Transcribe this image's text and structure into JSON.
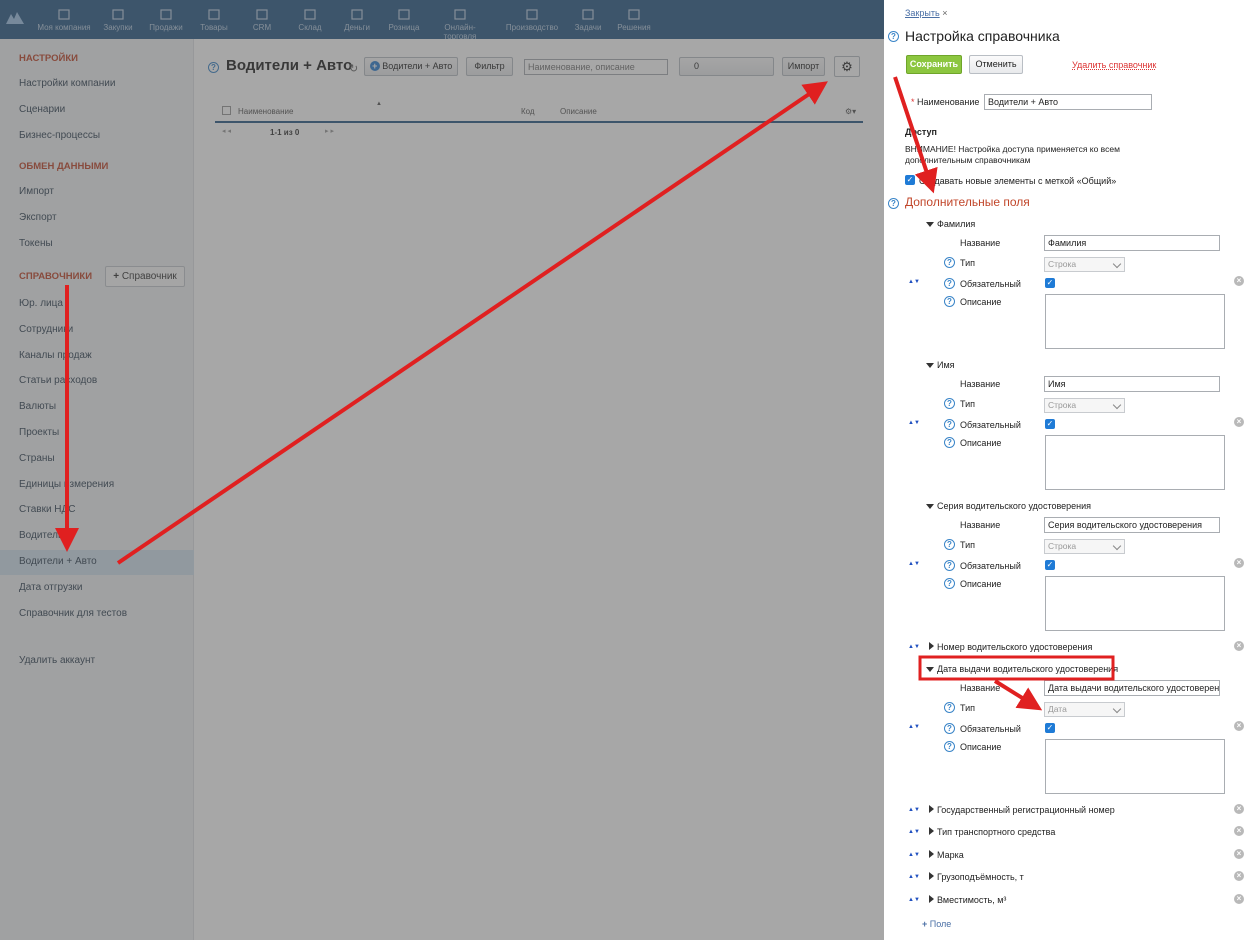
{
  "topnav": {
    "items": [
      "Моя компания",
      "Закупки",
      "Продажи",
      "Товары",
      "CRM",
      "Склад",
      "Деньги",
      "Розница",
      "Онлайн-торговля",
      "Производство",
      "Задачи",
      "Решения"
    ]
  },
  "sidebar": {
    "sections": {
      "settings": "НАСТРОЙКИ",
      "exchange": "ОБМЕН ДАННЫМИ",
      "references": "СПРАВОЧНИКИ"
    },
    "settings_items": [
      "Настройки компании",
      "Сценарии",
      "Бизнес-процессы"
    ],
    "exchange_items": [
      "Импорт",
      "Экспорт",
      "Токены"
    ],
    "add_reference_label": "Справочник",
    "reference_items": [
      "Юр. лица",
      "Сотрудники",
      "Каналы продаж",
      "Статьи расходов",
      "Валюты",
      "Проекты",
      "Страны",
      "Единицы измерения",
      "Ставки НДС",
      "Водители",
      "Водители + Авто",
      "Дата отгрузки",
      "Справочник для тестов"
    ],
    "delete_account": "Удалить аккаунт"
  },
  "main": {
    "title": "Водители + Авто",
    "add_button": "Водители + Авто",
    "filter_button": "Фильтр",
    "search_placeholder": "Наименование, описание",
    "counter": "0",
    "import_button": "Импорт",
    "columns": [
      "Наименование",
      "Код",
      "Описание"
    ],
    "pager": "1-1 из 0"
  },
  "panel": {
    "close_link": "Закрыть",
    "title": "Настройка справочника",
    "save_button": "Сохранить",
    "cancel_button": "Отменить",
    "delete_link": "Удалить справочник",
    "name_label": "Наименование",
    "name_value": "Водители + Авто",
    "access_heading": "Доступ",
    "access_warning_line1": "ВНИМАНИЕ! Настройка доступа применяется ко всем",
    "access_warning_line2": "дополнительным справочникам",
    "access_checkbox_label": "Создавать новые элементы с меткой «Общий»",
    "extra_fields_heading": "Дополнительные поля",
    "labels": {
      "name": "Название",
      "type": "Тип",
      "required": "Обязательный",
      "description": "Описание"
    },
    "expanded_fields": [
      {
        "title": "Фамилия",
        "name_value": "Фамилия",
        "type": "Строка"
      },
      {
        "title": "Имя",
        "name_value": "Имя",
        "type": "Строка"
      },
      {
        "title": "Серия водительского удостоверения",
        "name_value": "Серия водительского удостоверения",
        "type": "Строка"
      }
    ],
    "collapsed_field_1": "Номер водительского удостоверения",
    "highlighted_field": {
      "title": "Дата выдачи водительского удостоверения",
      "name_value": "Дата выдачи водительского удостоверения",
      "type": "Дата"
    },
    "collapsed_fields": [
      "Государственный регистрационный номер",
      "Тип транспортного средства",
      "Марка",
      "Грузоподъёмность, т",
      "Вместимость, м³"
    ],
    "add_field_link": "Поле"
  },
  "colors": {
    "topbar": "#2a5a86",
    "accent_red": "#e02020",
    "section_heading": "#c1462a",
    "save_green": "#8cc63f"
  }
}
